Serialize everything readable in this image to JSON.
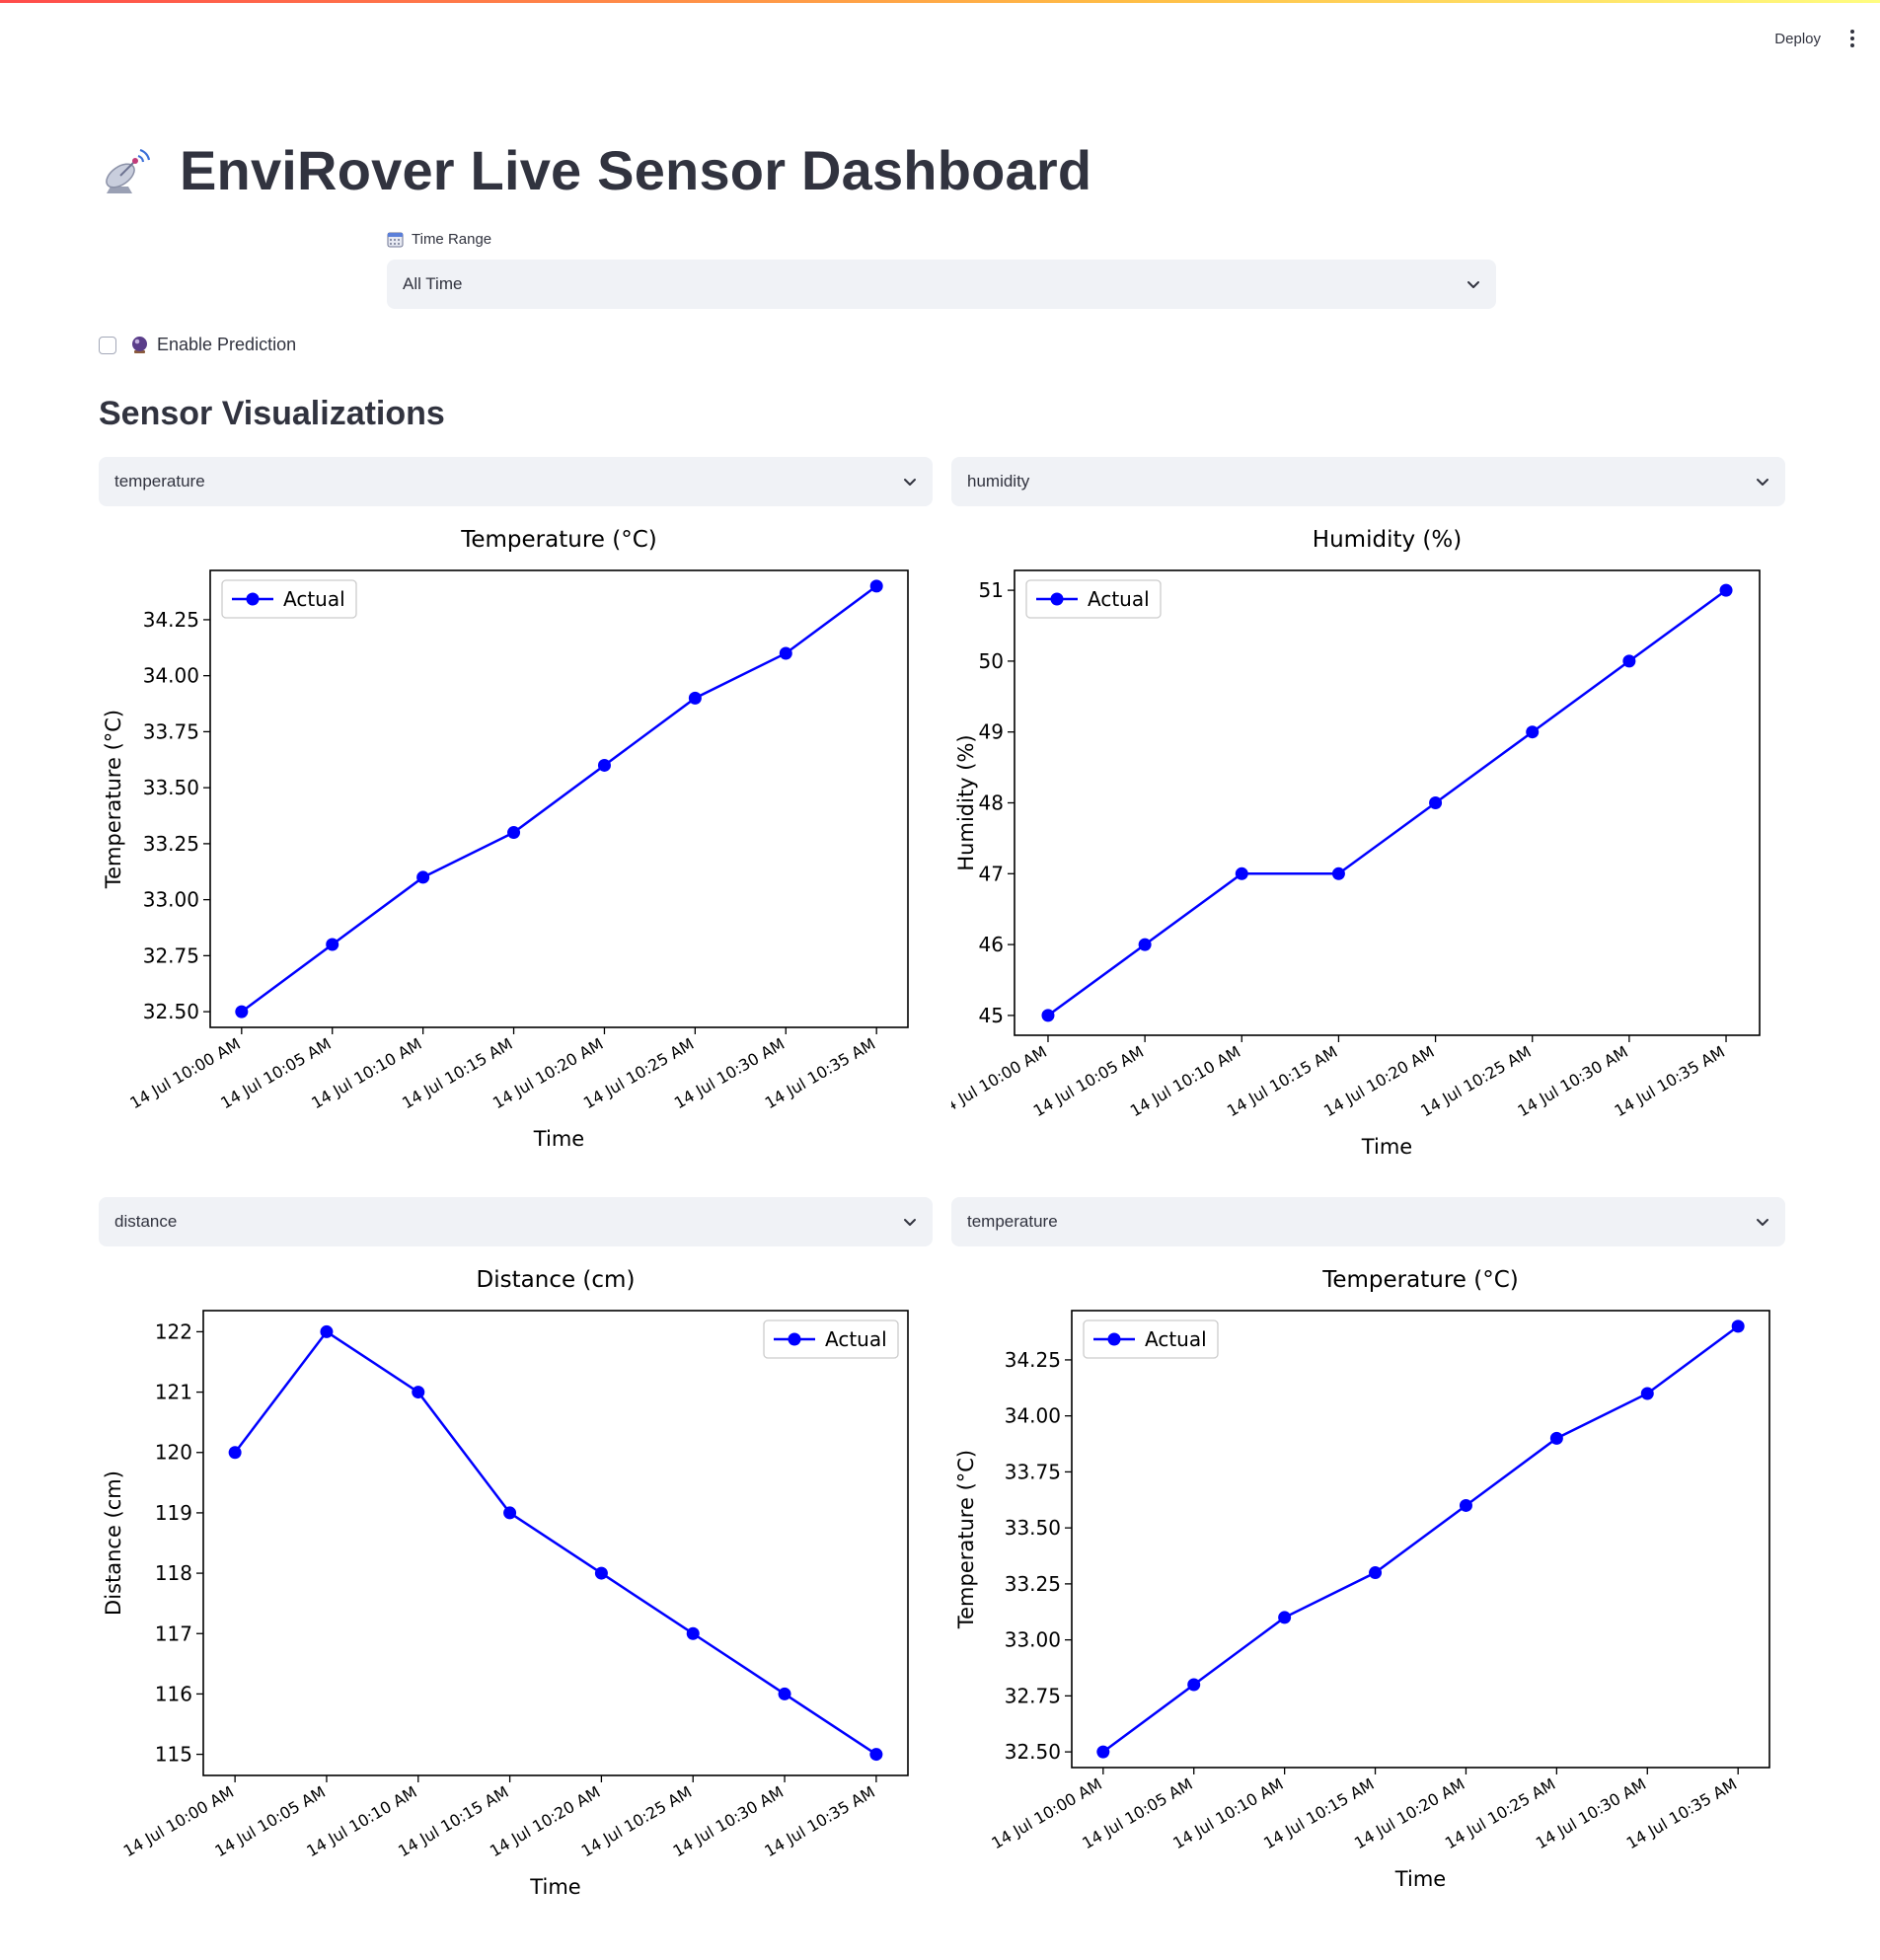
{
  "header": {
    "deploy_label": "Deploy"
  },
  "title": {
    "text": "EnviRover Live Sensor Dashboard",
    "icon": "satellite-dish-icon"
  },
  "time_range": {
    "label": "Time Range",
    "icon": "calendar-icon",
    "selected": "All Time"
  },
  "prediction": {
    "label": "Enable Prediction",
    "icon": "crystal-ball-icon",
    "checked": false
  },
  "section": {
    "heading": "Sensor Visualizations"
  },
  "colors": {
    "line": "#0000ff",
    "select_bg": "#f0f2f6",
    "text": "#31333f"
  },
  "panels": [
    {
      "selected": "temperature"
    },
    {
      "selected": "humidity"
    },
    {
      "selected": "distance"
    },
    {
      "selected": "temperature"
    }
  ],
  "chart_data": [
    {
      "type": "line",
      "title": "Temperature (°C)",
      "xlabel": "Time",
      "ylabel": "Temperature (°C)",
      "x": [
        "14 Jul 10:00 AM",
        "14 Jul 10:05 AM",
        "14 Jul 10:10 AM",
        "14 Jul 10:15 AM",
        "14 Jul 10:20 AM",
        "14 Jul 10:25 AM",
        "14 Jul 10:30 AM",
        "14 Jul 10:35 AM"
      ],
      "yticks": [
        "32.50",
        "32.75",
        "33.00",
        "33.25",
        "33.50",
        "33.75",
        "34.00",
        "34.25"
      ],
      "ylim": [
        32.43,
        34.47
      ],
      "legend_position": "top-left",
      "series": [
        {
          "name": "Actual",
          "values": [
            32.5,
            32.8,
            33.1,
            33.3,
            33.6,
            33.9,
            34.1,
            34.4
          ]
        }
      ]
    },
    {
      "type": "line",
      "title": "Humidity (%)",
      "xlabel": "Time",
      "ylabel": "Humidity (%)",
      "x": [
        "14 Jul 10:00 AM",
        "14 Jul 10:05 AM",
        "14 Jul 10:10 AM",
        "14 Jul 10:15 AM",
        "14 Jul 10:20 AM",
        "14 Jul 10:25 AM",
        "14 Jul 10:30 AM",
        "14 Jul 10:35 AM"
      ],
      "yticks": [
        "45",
        "46",
        "47",
        "48",
        "49",
        "50",
        "51"
      ],
      "ylim": [
        44.72,
        51.28
      ],
      "legend_position": "top-left",
      "series": [
        {
          "name": "Actual",
          "values": [
            45,
            46,
            47,
            47,
            48,
            49,
            50,
            51
          ]
        }
      ]
    },
    {
      "type": "line",
      "title": "Distance (cm)",
      "xlabel": "Time",
      "ylabel": "Distance (cm)",
      "x": [
        "14 Jul 10:00 AM",
        "14 Jul 10:05 AM",
        "14 Jul 10:10 AM",
        "14 Jul 10:15 AM",
        "14 Jul 10:20 AM",
        "14 Jul 10:25 AM",
        "14 Jul 10:30 AM",
        "14 Jul 10:35 AM"
      ],
      "yticks": [
        "115",
        "116",
        "117",
        "118",
        "119",
        "120",
        "121",
        "122"
      ],
      "ylim": [
        114.65,
        122.35
      ],
      "legend_position": "top-right",
      "series": [
        {
          "name": "Actual",
          "values": [
            120,
            122,
            121,
            119,
            118,
            117,
            116,
            115
          ]
        }
      ]
    },
    {
      "type": "line",
      "title": "Temperature (°C)",
      "xlabel": "Time",
      "ylabel": "Temperature (°C)",
      "x": [
        "14 Jul 10:00 AM",
        "14 Jul 10:05 AM",
        "14 Jul 10:10 AM",
        "14 Jul 10:15 AM",
        "14 Jul 10:20 AM",
        "14 Jul 10:25 AM",
        "14 Jul 10:30 AM",
        "14 Jul 10:35 AM"
      ],
      "yticks": [
        "32.50",
        "32.75",
        "33.00",
        "33.25",
        "33.50",
        "33.75",
        "34.00",
        "34.25"
      ],
      "ylim": [
        32.43,
        34.47
      ],
      "legend_position": "top-left",
      "series": [
        {
          "name": "Actual",
          "values": [
            32.5,
            32.8,
            33.1,
            33.3,
            33.6,
            33.9,
            34.1,
            34.4
          ]
        }
      ]
    }
  ]
}
